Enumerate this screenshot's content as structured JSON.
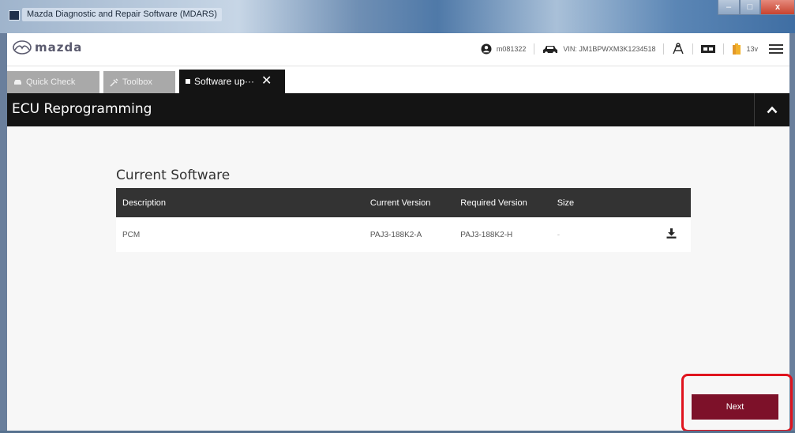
{
  "window": {
    "title": "Mazda Diagnostic and Repair Software (MDARS)",
    "controls": {
      "minimize": "–",
      "maximize": "□",
      "close": "x"
    }
  },
  "header": {
    "brand": "mazda",
    "user": "m081322",
    "vin": "VIN: JM1BPWXM3K1234518",
    "battery": "13v"
  },
  "tabs": [
    {
      "label": "Quick Check",
      "icon": "car-icon",
      "active": false
    },
    {
      "label": "Toolbox",
      "icon": "tools-icon",
      "active": false
    },
    {
      "label": "Software up···",
      "icon": "square-icon",
      "active": true,
      "close": "✕"
    }
  ],
  "section": {
    "title": "ECU Reprogramming"
  },
  "current_software": {
    "heading": "Current Software",
    "columns": [
      "Description",
      "Current Version",
      "Required Version",
      "Size",
      ""
    ],
    "rows": [
      {
        "description": "PCM",
        "current_version": "PAJ3-188K2-A",
        "required_version": "PAJ3-188K2-H",
        "size": "-"
      }
    ]
  },
  "footer": {
    "next_label": "Next"
  },
  "colors": {
    "accent": "#7d1129",
    "header_dark": "#141414",
    "table_header": "#333333",
    "highlight": "#e0141e"
  }
}
